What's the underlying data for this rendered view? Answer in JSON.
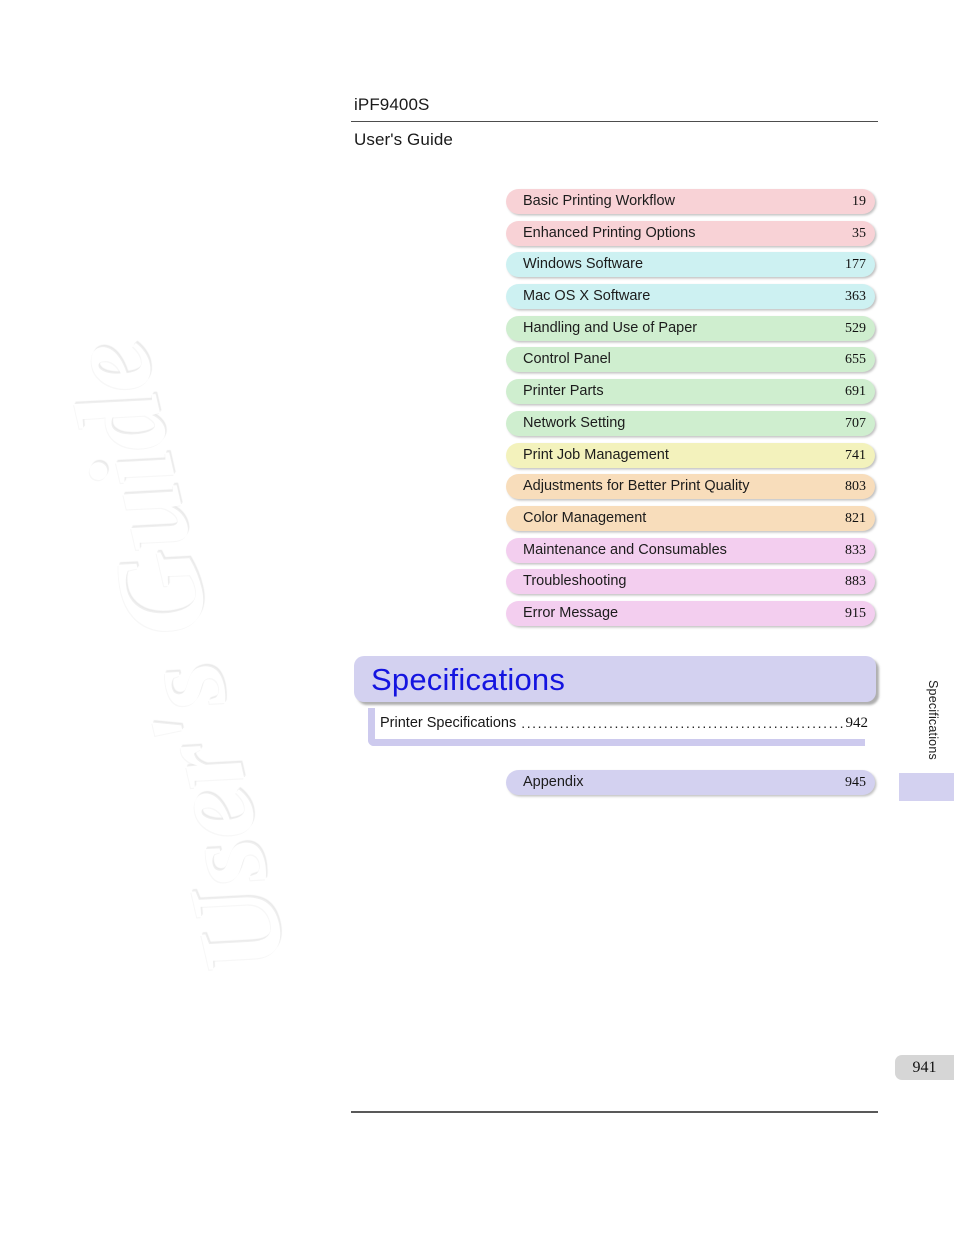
{
  "header": {
    "product": "iPF9400S",
    "guide": "User's Guide"
  },
  "watermark": {
    "text": "User's Guide"
  },
  "colors": {
    "pink": "#f8d2d6",
    "cyan": "#cdf1f2",
    "green": "#cfeecf",
    "yellow": "#f3f2bc",
    "orange": "#f8ddbb",
    "violet": "#f3ceef",
    "lavender": "#d3d1f0",
    "title_text": "#1414e0",
    "page_box": "#d6d6d6"
  },
  "chapters": [
    {
      "label": "Basic Printing Workflow",
      "page": "19",
      "color": "#f8d2d6"
    },
    {
      "label": "Enhanced Printing Options",
      "page": "35",
      "color": "#f8d2d6"
    },
    {
      "label": "Windows Software",
      "page": "177",
      "color": "#cdf1f2"
    },
    {
      "label": "Mac OS X Software",
      "page": "363",
      "color": "#cdf1f2"
    },
    {
      "label": "Handling and Use of Paper",
      "page": "529",
      "color": "#cfeecf"
    },
    {
      "label": "Control Panel",
      "page": "655",
      "color": "#cfeecf"
    },
    {
      "label": "Printer Parts",
      "page": "691",
      "color": "#cfeecf"
    },
    {
      "label": "Network Setting",
      "page": "707",
      "color": "#cfeecf"
    },
    {
      "label": "Print Job Management",
      "page": "741",
      "color": "#f3f2bc"
    },
    {
      "label": "Adjustments for Better Print Quality",
      "page": "803",
      "color": "#f8ddbb"
    },
    {
      "label": "Color Management",
      "page": "821",
      "color": "#f8ddbb"
    },
    {
      "label": "Maintenance and Consumables",
      "page": "833",
      "color": "#f3ceef"
    },
    {
      "label": "Troubleshooting",
      "page": "883",
      "color": "#f3ceef"
    },
    {
      "label": "Error Message",
      "page": "915",
      "color": "#f3ceef"
    }
  ],
  "current_section": {
    "title": "Specifications",
    "entries": [
      {
        "name": "Printer Specifications",
        "page": "942"
      }
    ]
  },
  "appendix": {
    "label": "Appendix",
    "page": "945",
    "color": "#d3d1f0"
  },
  "side_tab": {
    "label": "Specifications"
  },
  "footer": {
    "page_number": "941"
  }
}
